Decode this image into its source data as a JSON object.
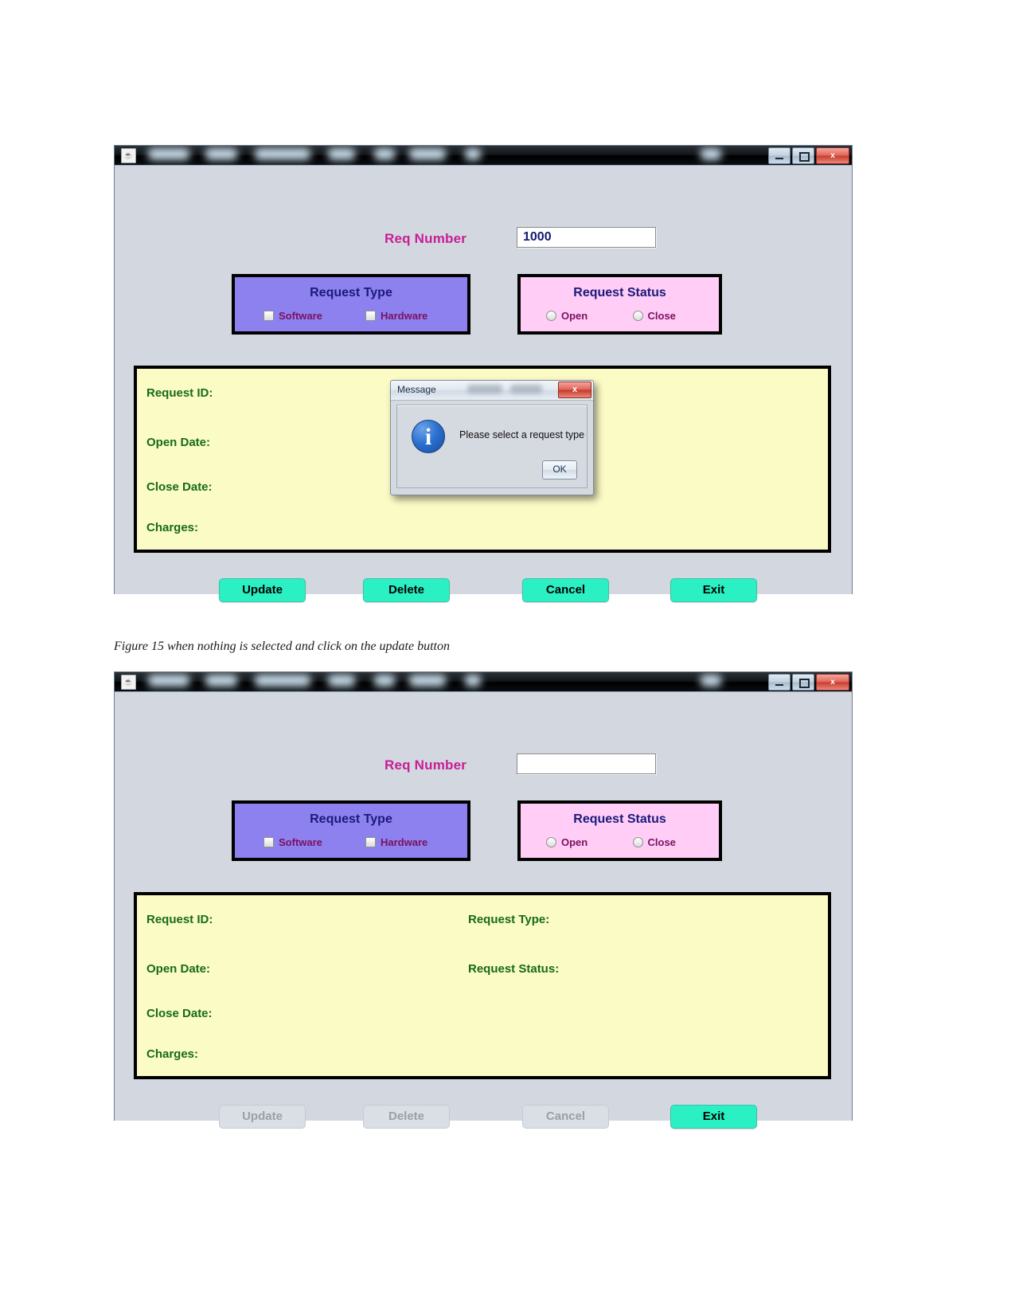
{
  "figure": {
    "caption": "Figure 15 when nothing is selected and click on the update button"
  },
  "window_controls": {
    "minimize_label": "",
    "maximize_label": "",
    "close_label": "x",
    "app_icon": "java-coffee-cup-icon"
  },
  "window_one": {
    "title": "",
    "req_number": {
      "label": "Req Number",
      "value": "1000",
      "placeholder": ""
    },
    "request_type": {
      "title": "Request Type",
      "options": [
        {
          "label": "Software",
          "checked": false
        },
        {
          "label": "Hardware",
          "checked": false
        }
      ]
    },
    "request_status": {
      "title": "Request Status",
      "options": [
        {
          "label": "Open",
          "selected": false
        },
        {
          "label": "Close",
          "selected": false
        }
      ]
    },
    "details": {
      "left_labels": [
        "Request ID:",
        "Open Date:",
        "Close Date:",
        "Charges:"
      ],
      "right_labels": []
    },
    "buttons": [
      {
        "label": "Update",
        "enabled": true
      },
      {
        "label": "Delete",
        "enabled": true
      },
      {
        "label": "Cancel",
        "enabled": true
      },
      {
        "label": "Exit",
        "enabled": true
      }
    ],
    "dialog": {
      "title": "Message",
      "message": "Please select a request type",
      "ok_label": "OK",
      "close_label": "x",
      "icon": "info-icon"
    }
  },
  "window_two": {
    "title": "",
    "req_number": {
      "label": "Req Number",
      "value": "",
      "placeholder": ""
    },
    "request_type": {
      "title": "Request Type",
      "options": [
        {
          "label": "Software",
          "checked": false
        },
        {
          "label": "Hardware",
          "checked": false
        }
      ]
    },
    "request_status": {
      "title": "Request Status",
      "options": [
        {
          "label": "Open",
          "selected": false
        },
        {
          "label": "Close",
          "selected": false
        }
      ]
    },
    "details": {
      "left_labels": [
        "Request ID:",
        "Open Date:",
        "Close Date:",
        "Charges:"
      ],
      "right_labels": [
        "Request Type:",
        "Request Status:"
      ]
    },
    "buttons": [
      {
        "label": "Update",
        "enabled": false
      },
      {
        "label": "Delete",
        "enabled": false
      },
      {
        "label": "Cancel",
        "enabled": false
      },
      {
        "label": "Exit",
        "enabled": true
      }
    ]
  },
  "colors": {
    "window_bg": "#d3d7df",
    "request_type_panel": "#8d81ef",
    "request_status_panel": "#ffcdf6",
    "detail_panel": "#fbfbc6",
    "button_accent": "#2bf0c4",
    "label_magenta": "#c81e96",
    "label_green": "#176b18",
    "title_navy": "#1b1a7a"
  }
}
